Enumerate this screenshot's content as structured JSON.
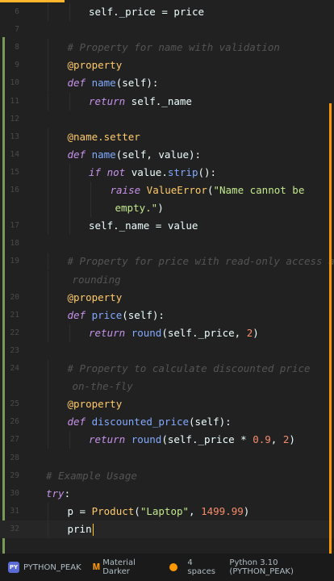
{
  "editor": {
    "lines": [
      {
        "n": "6",
        "segs": [
          [
            "self",
            "self"
          ],
          [
            "._price = price",
            ""
          ]
        ],
        "indent": 2
      },
      {
        "n": "7",
        "segs": [],
        "indent": 0
      },
      {
        "n": "8",
        "segs": [
          [
            "# Property for name with validation",
            "cm"
          ]
        ],
        "indent": 1
      },
      {
        "n": "9",
        "segs": [
          [
            "@property",
            "dec"
          ]
        ],
        "indent": 1
      },
      {
        "n": "10",
        "segs": [
          [
            "def",
            "kw"
          ],
          [
            " ",
            ""
          ],
          [
            "name",
            "fn"
          ],
          [
            "(self):",
            ""
          ]
        ],
        "indent": 1
      },
      {
        "n": "11",
        "segs": [
          [
            "return",
            "kw"
          ],
          [
            " self._name",
            ""
          ]
        ],
        "indent": 2
      },
      {
        "n": "12",
        "segs": [],
        "indent": 0
      },
      {
        "n": "13",
        "segs": [
          [
            "@name.setter",
            "dec"
          ]
        ],
        "indent": 1
      },
      {
        "n": "14",
        "segs": [
          [
            "def",
            "kw"
          ],
          [
            " ",
            ""
          ],
          [
            "name",
            "fn"
          ],
          [
            "(self, value):",
            ""
          ]
        ],
        "indent": 1
      },
      {
        "n": "15",
        "segs": [
          [
            "if",
            "kw"
          ],
          [
            " ",
            ""
          ],
          [
            "not",
            "kw"
          ],
          [
            " value.",
            ""
          ],
          [
            "strip",
            "fn"
          ],
          [
            "():",
            ""
          ]
        ],
        "indent": 2
      },
      {
        "n": "16",
        "segs": [
          [
            "raise",
            "kw"
          ],
          [
            " ",
            ""
          ],
          [
            "ValueError",
            "dec"
          ],
          [
            "(",
            ""
          ],
          [
            "\"Name cannot be",
            "str"
          ]
        ],
        "indent": 3
      },
      {
        "n": "",
        "segs": [
          [
            "empty.\"",
            "str"
          ],
          [
            ")",
            ""
          ]
        ],
        "indent": 3,
        "wrap": true
      },
      {
        "n": "17",
        "segs": [
          [
            "self._name = value",
            ""
          ]
        ],
        "indent": 2
      },
      {
        "n": "18",
        "segs": [],
        "indent": 0
      },
      {
        "n": "19",
        "segs": [
          [
            "# Property for price with read-only access and",
            "cm"
          ]
        ],
        "indent": 1
      },
      {
        "n": "",
        "segs": [
          [
            "rounding",
            "cm"
          ]
        ],
        "indent": 1,
        "wrap": true
      },
      {
        "n": "20",
        "segs": [
          [
            "@property",
            "dec"
          ]
        ],
        "indent": 1
      },
      {
        "n": "21",
        "segs": [
          [
            "def",
            "kw"
          ],
          [
            " ",
            ""
          ],
          [
            "price",
            "fn"
          ],
          [
            "(self):",
            ""
          ]
        ],
        "indent": 1
      },
      {
        "n": "22",
        "segs": [
          [
            "return",
            "kw"
          ],
          [
            " ",
            ""
          ],
          [
            "round",
            "fn"
          ],
          [
            "(self._price, ",
            ""
          ],
          [
            "2",
            "num"
          ],
          [
            ")",
            ""
          ]
        ],
        "indent": 2
      },
      {
        "n": "23",
        "segs": [],
        "indent": 0
      },
      {
        "n": "24",
        "segs": [
          [
            "# Property to calculate discounted price",
            "cm"
          ]
        ],
        "indent": 1
      },
      {
        "n": "",
        "segs": [
          [
            "on-the-fly",
            "cm"
          ]
        ],
        "indent": 1,
        "wrap": true
      },
      {
        "n": "25",
        "segs": [
          [
            "@property",
            "dec"
          ]
        ],
        "indent": 1
      },
      {
        "n": "26",
        "segs": [
          [
            "def",
            "kw"
          ],
          [
            " ",
            ""
          ],
          [
            "discounted_price",
            "fn"
          ],
          [
            "(self):",
            ""
          ]
        ],
        "indent": 1
      },
      {
        "n": "27",
        "segs": [
          [
            "return",
            "kw"
          ],
          [
            " ",
            ""
          ],
          [
            "round",
            "fn"
          ],
          [
            "(self._price * ",
            ""
          ],
          [
            "0.9",
            "num"
          ],
          [
            ", ",
            ""
          ],
          [
            "2",
            "num"
          ],
          [
            ")",
            ""
          ]
        ],
        "indent": 2
      },
      {
        "n": "28",
        "segs": [],
        "indent": 0
      },
      {
        "n": "29",
        "segs": [
          [
            "# Example Usage",
            "cm"
          ]
        ],
        "indent": 0
      },
      {
        "n": "30",
        "segs": [
          [
            "try",
            "kw"
          ],
          [
            ":",
            ""
          ]
        ],
        "indent": 0
      },
      {
        "n": "31",
        "segs": [
          [
            "p = ",
            ""
          ],
          [
            "Product",
            "dec"
          ],
          [
            "(",
            ""
          ],
          [
            "\"Laptop\"",
            "str"
          ],
          [
            ", ",
            ""
          ],
          [
            "1499.99",
            "num"
          ],
          [
            ")",
            ""
          ]
        ],
        "indent": 1
      },
      {
        "n": "32",
        "segs": [
          [
            "prin",
            ""
          ]
        ],
        "indent": 1,
        "current": true
      }
    ]
  },
  "statusbar": {
    "project_badge": "PY",
    "project": "PYTHON_PEAK",
    "theme": "Material Darker",
    "indent": "4 spaces",
    "interpreter": "Python 3.10 (PYTHON_PEAK)"
  },
  "colors": {
    "background": "#212121",
    "accent": "#ff9800",
    "keyword": "#c792ea",
    "function": "#82aaff",
    "string": "#c3e88d",
    "number": "#f78c6c",
    "comment": "#545454",
    "decorator": "#ffcb6b"
  }
}
